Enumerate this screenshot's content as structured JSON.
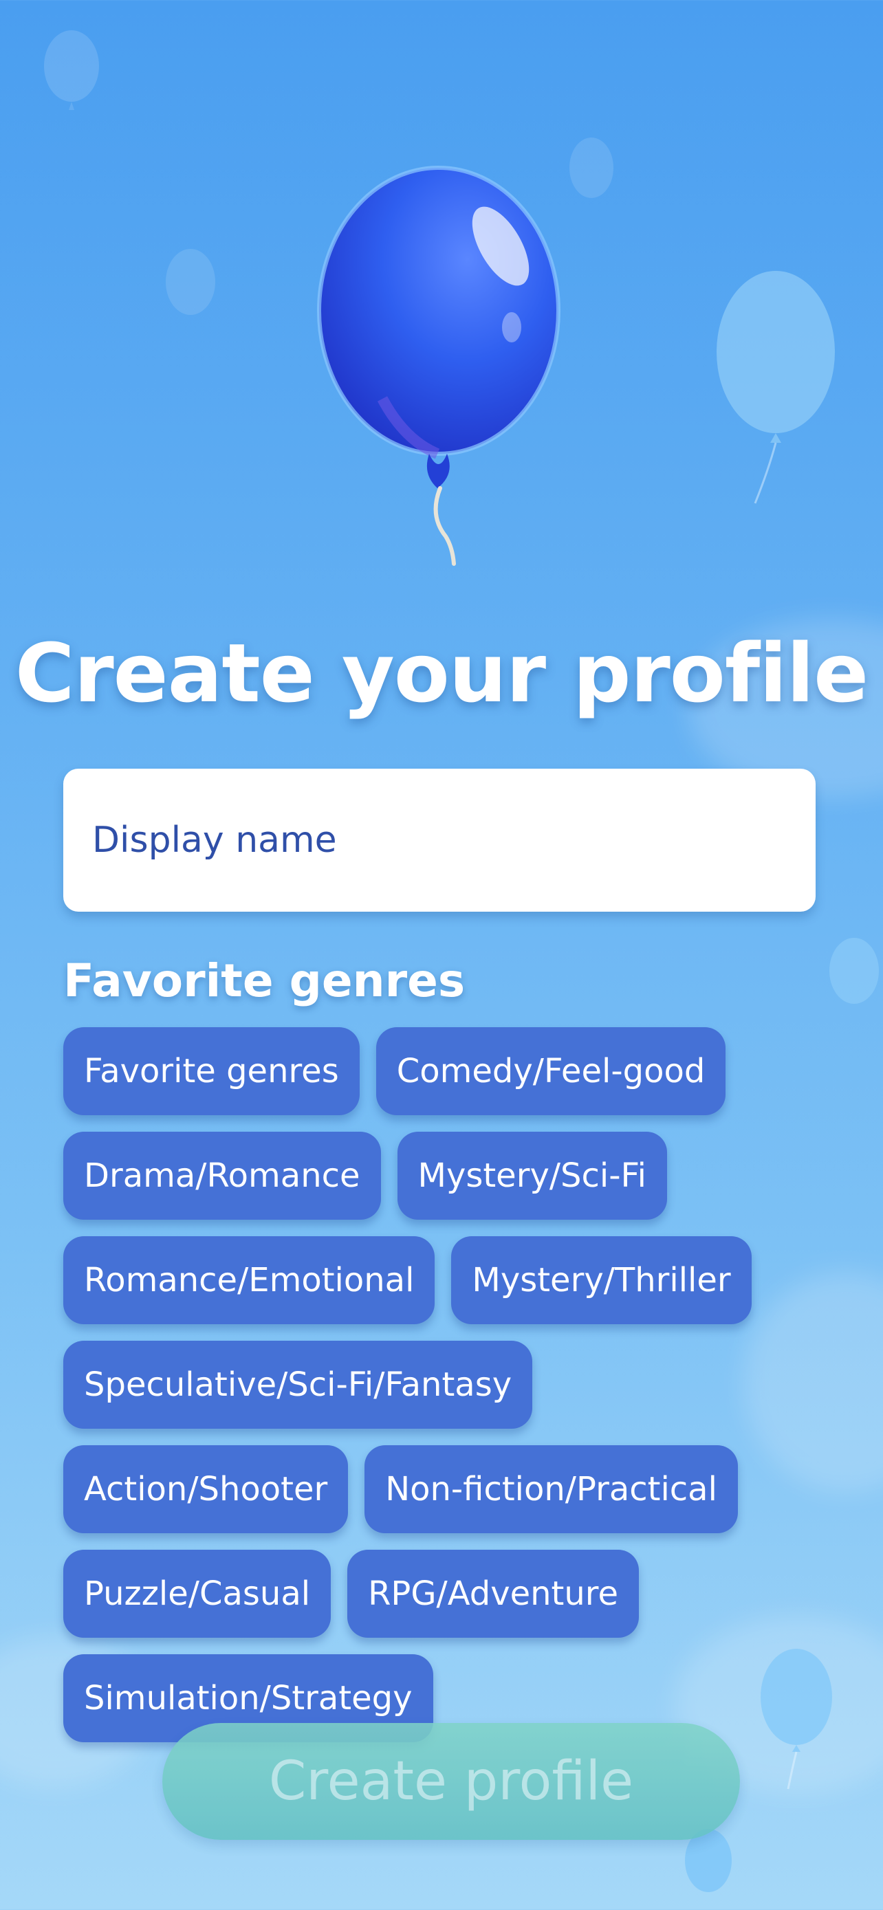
{
  "header": {
    "title": "Create your profile"
  },
  "form": {
    "display_name_placeholder": "Display name",
    "display_name_value": ""
  },
  "genres": {
    "section_title": "Favorite genres",
    "items": [
      {
        "label": "Favorite genres"
      },
      {
        "label": "Comedy/Feel-good"
      },
      {
        "label": "Drama/Romance"
      },
      {
        "label": "Mystery/Sci-Fi"
      },
      {
        "label": "Romance/Emotional"
      },
      {
        "label": "Mystery/Thriller"
      },
      {
        "label": "Speculative/Sci-Fi/Fantasy"
      },
      {
        "label": "Action/Shooter"
      },
      {
        "label": "Non-fiction/Practical"
      },
      {
        "label": "Puzzle/Casual"
      },
      {
        "label": "RPG/Adventure"
      },
      {
        "label": "Simulation/Strategy"
      }
    ]
  },
  "actions": {
    "create_label": "Create profile"
  },
  "decor": {
    "hero_icon": "balloon-icon",
    "background_icon": "balloon-icon",
    "colors": {
      "chip": "#4571d6",
      "button": "#7fd3c7",
      "hero_balloon": "#2f5ff0"
    }
  }
}
